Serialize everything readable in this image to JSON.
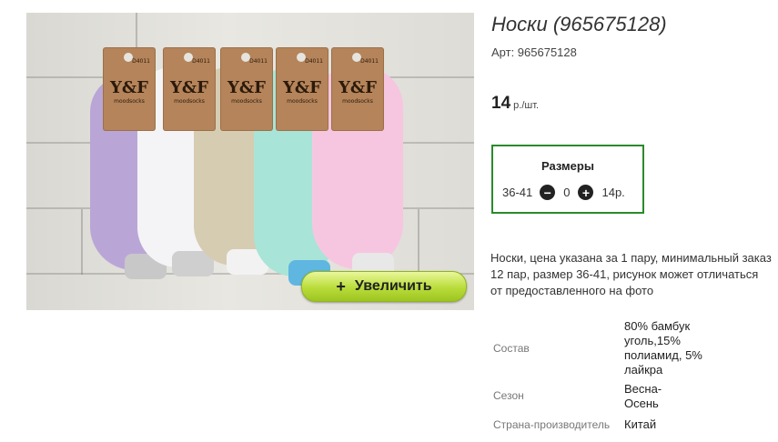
{
  "product": {
    "title": "Носки (965675128)",
    "article": "Арт: 965675128",
    "price_value": "14",
    "price_unit": "р./шт.",
    "zoom_button": "Увеличить",
    "zoom_plus": "+",
    "description": "Носки, цена указана за 1 пару, минимальный заказ 12 пар, размер 36-41, рисунок может отличаться от предоставленного на фото"
  },
  "photo": {
    "tag_brand": "Y&F",
    "tag_code": "D4011",
    "tag_sub": "moodsocks"
  },
  "sizes": {
    "title": "Размеры",
    "rows": [
      {
        "size": "36-41",
        "qty": "0",
        "price": "14р."
      }
    ],
    "minus_icon": "minus-circle-icon",
    "plus_icon": "plus-circle-icon"
  },
  "properties": [
    {
      "name": "Состав",
      "value": "80% бамбук уголь,15% полиамид, 5% лайкра"
    },
    {
      "name": "Сезон",
      "value": "Весна-Осень"
    },
    {
      "name": "Страна-производитель",
      "value": "Китай"
    }
  ],
  "colors": {
    "sizes_border": "#2b8a2b",
    "zoom_button": "#b9dc3a"
  }
}
